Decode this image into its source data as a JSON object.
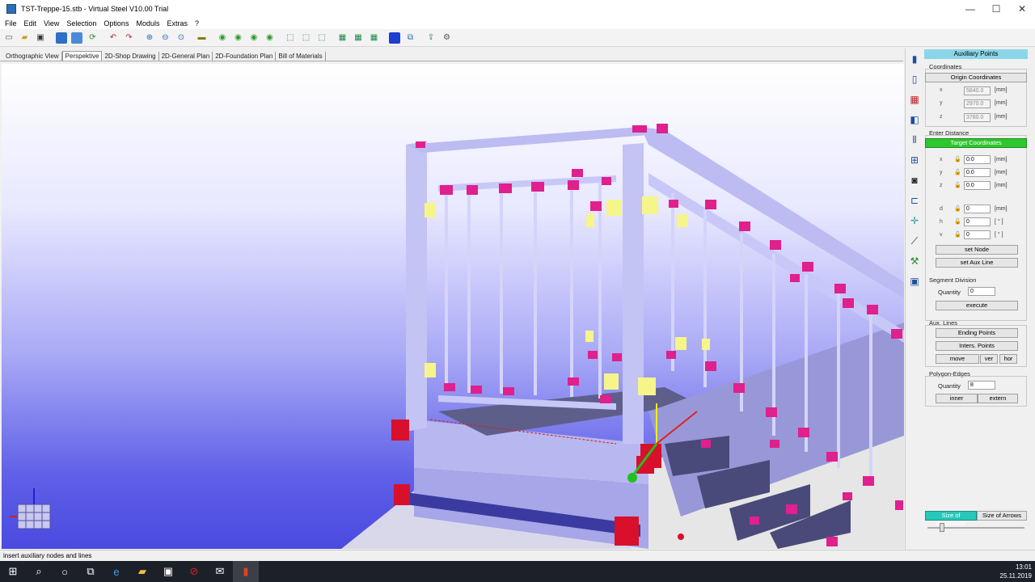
{
  "window": {
    "title": "TST-Treppe-15.stb - Virtual Steel V10.00 Trial",
    "minimize": "—",
    "maximize": "☐",
    "close": "✕"
  },
  "menu": [
    "File",
    "Edit",
    "View",
    "Selection",
    "Options",
    "Moduls",
    "Extras",
    "?"
  ],
  "tabs": [
    "Orthographic View",
    "Perspektive",
    "2D-Shop Drawing",
    "2D-General Plan",
    "2D-Foundation Plan",
    "Bill of Materials"
  ],
  "active_tab": "Perspektive",
  "panel": {
    "header": "Auxiliary Points",
    "coordinates_label": "Coordinates",
    "origin_button": "Origin Coordinates",
    "origin": [
      {
        "axis": "x",
        "value": "5840.0",
        "unit": "[mm]"
      },
      {
        "axis": "y",
        "value": "2970.0",
        "unit": "[mm]"
      },
      {
        "axis": "z",
        "value": "3780.0",
        "unit": "[mm]"
      }
    ],
    "enter_distance_label": "Enter Distance",
    "target_button": "Target Coordinates",
    "target": [
      {
        "axis": "x",
        "value": "0.0",
        "unit": "[mm]"
      },
      {
        "axis": "y",
        "value": "0.0",
        "unit": "[mm]"
      },
      {
        "axis": "z",
        "value": "0.0",
        "unit": "[mm]"
      }
    ],
    "dist": [
      {
        "axis": "d",
        "value": "0",
        "unit": "[mm]"
      },
      {
        "axis": "h",
        "value": "0",
        "unit": "[ ° ]"
      },
      {
        "axis": "v",
        "value": "0",
        "unit": "[ ° ]"
      }
    ],
    "set_node": "set Node",
    "set_aux_line": "set Aux Line",
    "segment_division_label": "Segment Division",
    "quantity_label": "Quantity",
    "segment_quantity": "0",
    "execute": "execute",
    "aux_lines_label": "Aux. Lines",
    "ending_points": "Ending Points",
    "inters_points": "Inters. Points",
    "move": "move",
    "ver": "ver",
    "hor": "hor",
    "polygon_label": "Polygon-Edges",
    "polygon_quantity_label": "Quantity",
    "polygon_quantity": "8",
    "inner": "inner",
    "extern": "extern",
    "size_snappoints": "Size of Snappoints",
    "size_arrows": "Size of Arrows"
  },
  "status": "insert auxiliary nodes and lines",
  "clock": {
    "time": "13:01",
    "date": "25.11.2019"
  },
  "colors": {
    "accent_green": "#2ec72e",
    "node_magenta": "#e0208c",
    "node_red": "#d8102c",
    "marker_yellow": "#f5f58a",
    "steel": "#b4b4ee"
  }
}
